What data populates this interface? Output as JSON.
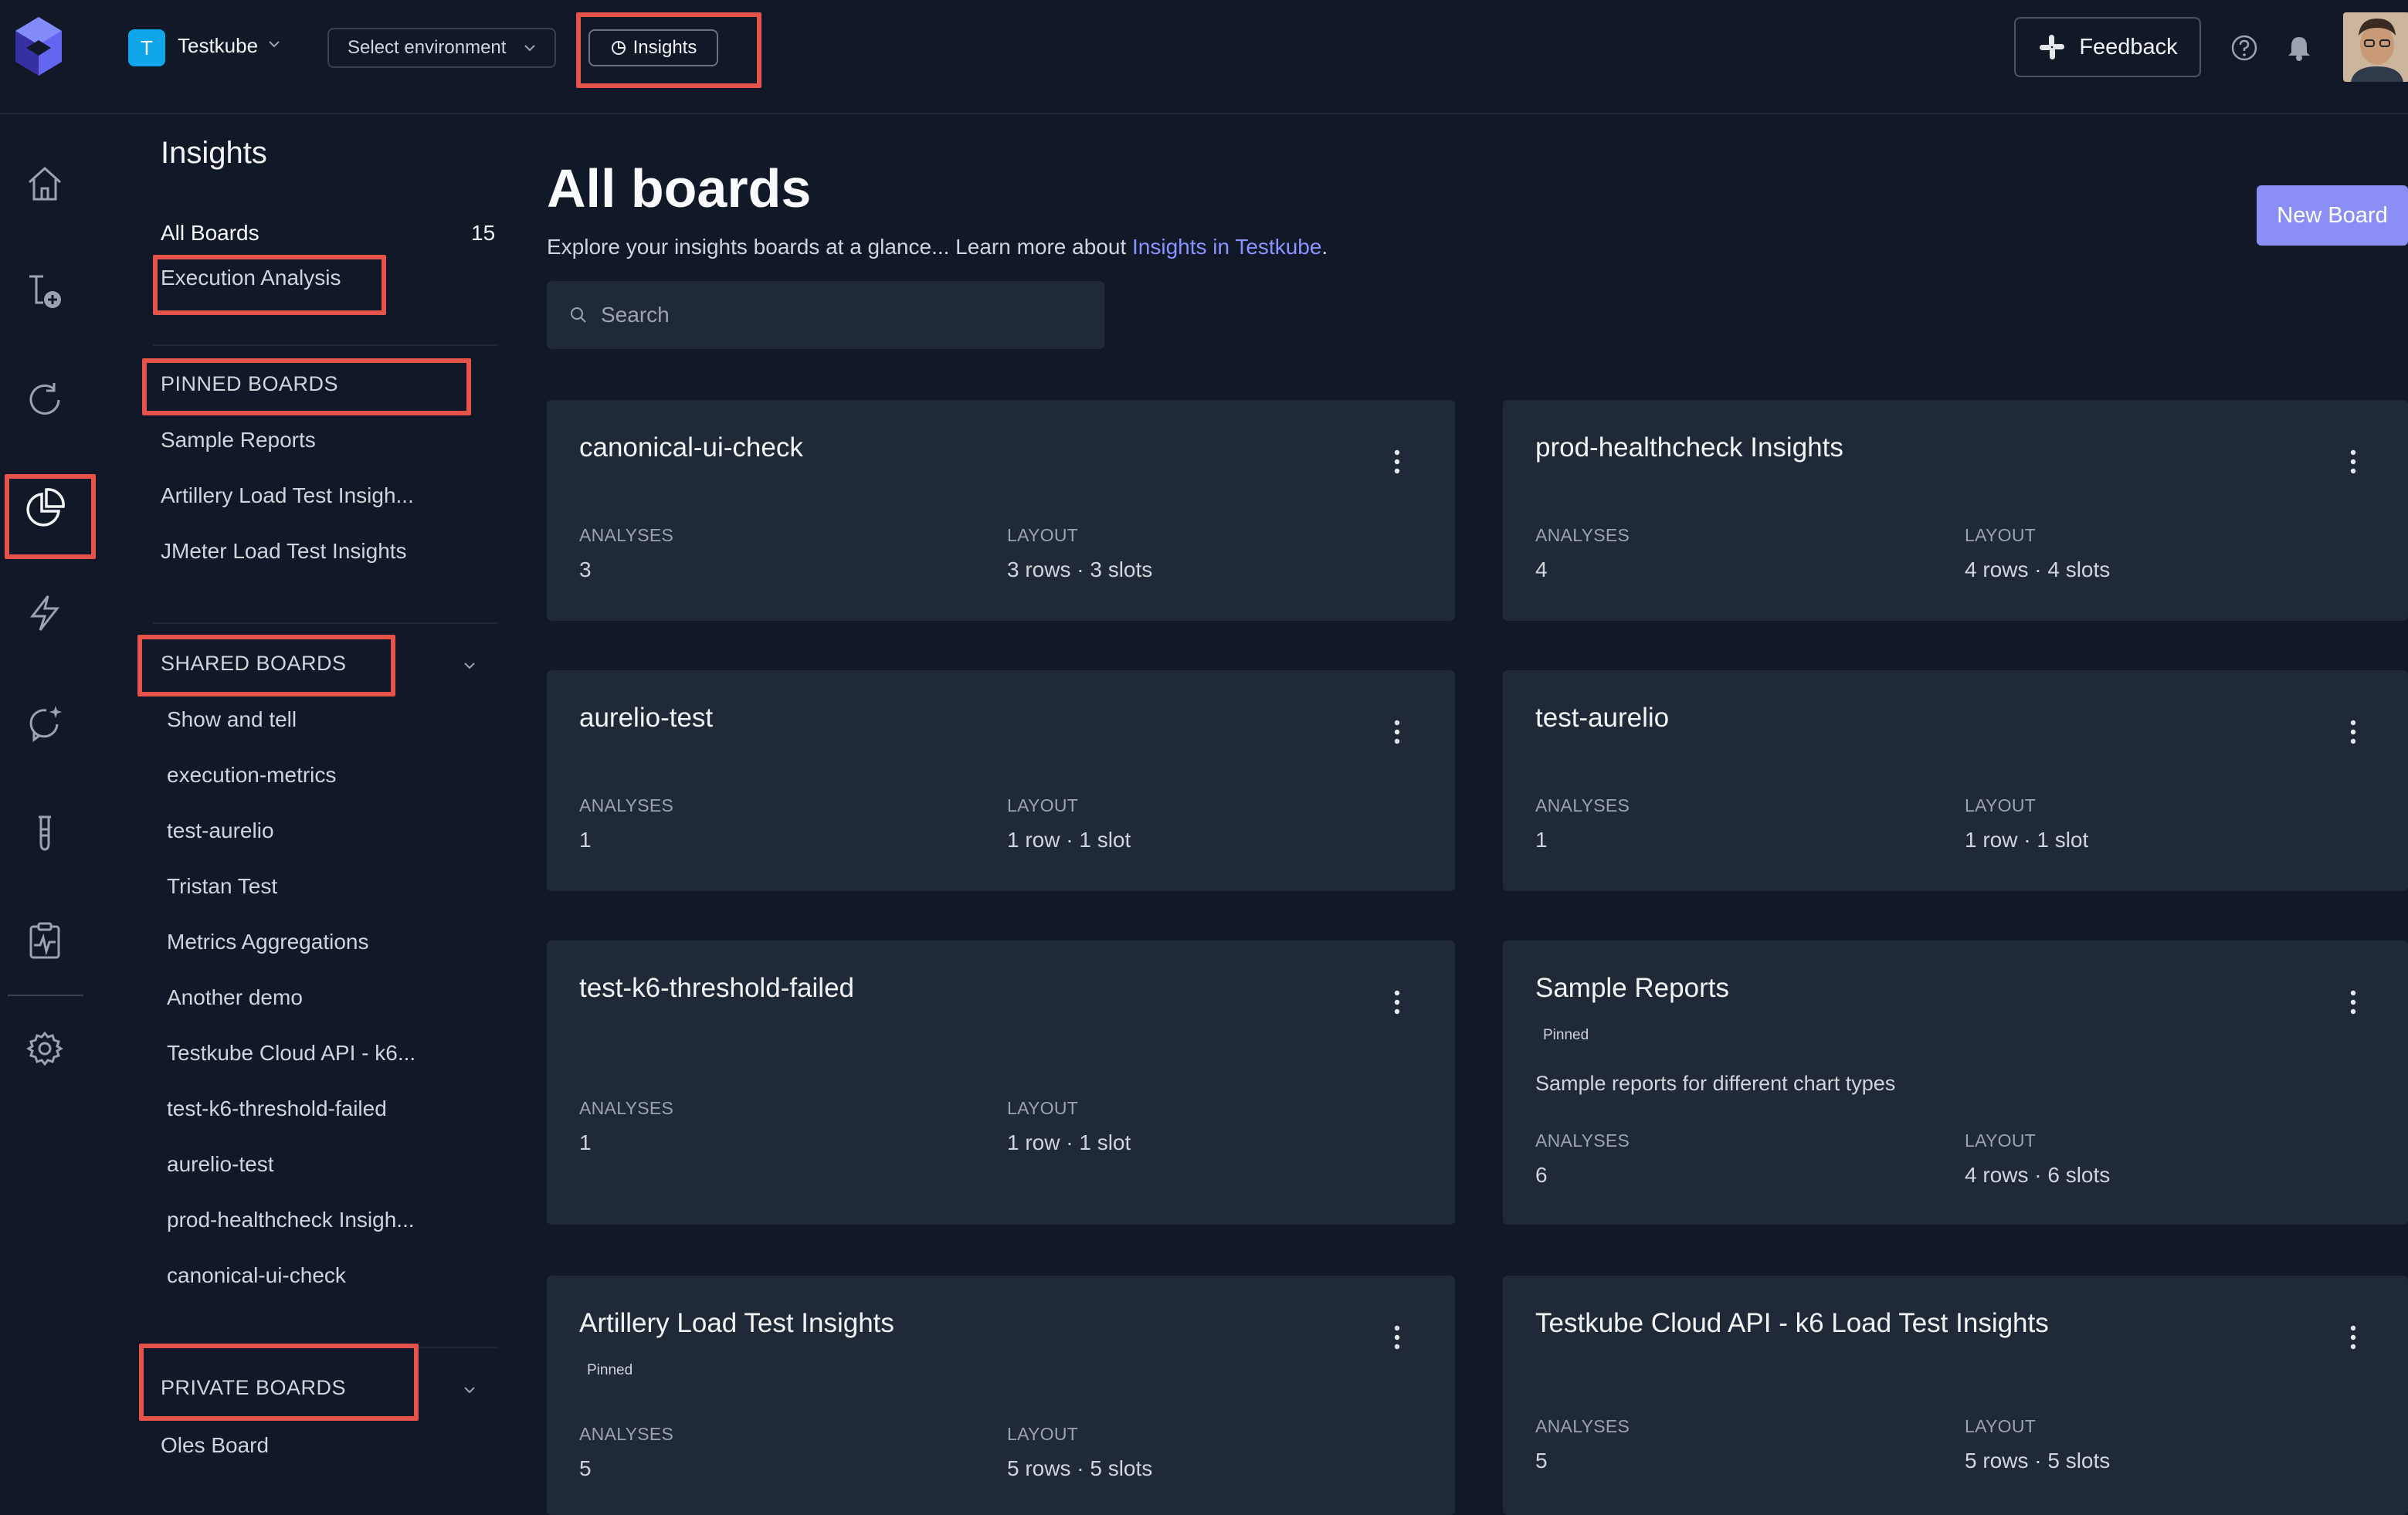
{
  "topbar": {
    "org_initial": "T",
    "org_name": "Testkube",
    "env_select": "Select environment",
    "insights_button": "Insights",
    "feedback": "Feedback"
  },
  "sidebar": {
    "title": "Insights",
    "all_boards_label": "All Boards",
    "all_boards_count": "15",
    "execution_analysis": "Execution Analysis",
    "pinned_header": "PINNED BOARDS",
    "pinned": [
      "Sample Reports",
      "Artillery Load Test Insigh...",
      "JMeter Load Test Insights"
    ],
    "shared_header": "SHARED BOARDS",
    "shared": [
      "Show and tell",
      "execution-metrics",
      "test-aurelio",
      "Tristan Test",
      "Metrics Aggregations",
      "Another demo",
      "Testkube Cloud API - k6...",
      "test-k6-threshold-failed",
      "aurelio-test",
      "prod-healthcheck Insigh...",
      "canonical-ui-check"
    ],
    "private_header": "PRIVATE BOARDS",
    "private": [
      "Oles Board"
    ]
  },
  "main": {
    "title": "All boards",
    "subtitle_text": "Explore your insights boards at a glance... Learn more about ",
    "subtitle_link": "Insights in Testkube",
    "subtitle_end": ".",
    "new_board": "New Board",
    "search_placeholder": "Search",
    "labels": {
      "analyses": "ANALYSES",
      "layout": "LAYOUT"
    },
    "cards": [
      {
        "title": "canonical-ui-check",
        "analyses": "3",
        "layout": "3 rows · 3 slots"
      },
      {
        "title": "prod-healthcheck Insights",
        "analyses": "4",
        "layout": "4 rows · 4 slots"
      },
      {
        "title": "aurelio-test",
        "analyses": "1",
        "layout": "1 row · 1 slot"
      },
      {
        "title": "test-aurelio",
        "analyses": "1",
        "layout": "1 row · 1 slot"
      },
      {
        "title": "test-k6-threshold-failed",
        "analyses": "1",
        "layout": "1 row · 1 slot"
      },
      {
        "title": "Sample Reports",
        "badge": "Pinned",
        "description": "Sample reports for different chart types",
        "analyses": "6",
        "layout": "4 rows · 6 slots"
      },
      {
        "title": "Artillery Load Test Insights",
        "badge": "Pinned",
        "analyses": "5",
        "layout": "5 rows · 5 slots"
      },
      {
        "title": "Testkube Cloud API - k6 Load Test Insights",
        "analyses": "5",
        "layout": "5 rows · 5 slots"
      }
    ]
  },
  "colors": {
    "background": "#111827",
    "card": "#1f2937",
    "accent": "#8b8ff5",
    "highlight": "#e5534b",
    "org_badge": "#0ea5e9"
  }
}
